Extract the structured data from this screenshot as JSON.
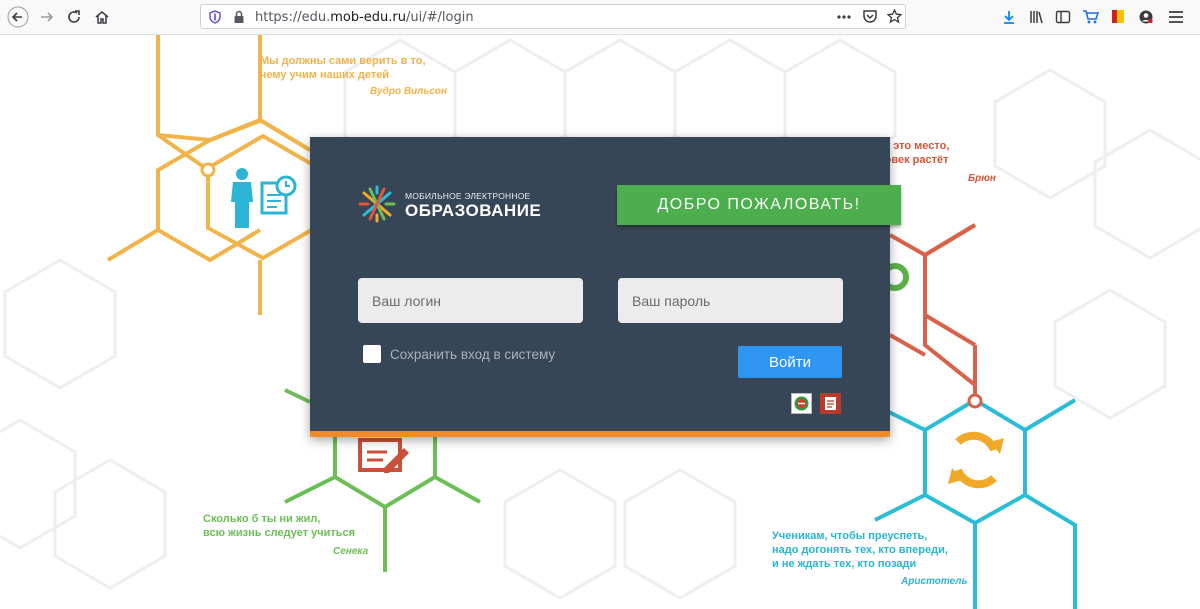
{
  "browser": {
    "url_prefix": "https://edu.",
    "url_domain": "mob-edu.ru",
    "url_suffix": "/ui/#/login"
  },
  "quotes": [
    {
      "text_line1": "Мы должны сами верить в то,",
      "text_line2": "чему учим наших детей",
      "author": "Вудро Вильсон",
      "color": "#f0b24a"
    },
    {
      "text_line1": "Школа – это место,",
      "text_line2": "где человек растёт",
      "author": "Брюн",
      "color": "#d4553b"
    },
    {
      "text_line1": "Сколько б ты ни жил,",
      "text_line2": "всю жизнь следует учиться",
      "author": "Сенека",
      "color": "#6cbe56"
    },
    {
      "text_line1": "Ученикам, чтобы преуспеть,",
      "text_line2": "надо догонять тех, кто впереди,",
      "text_line3": "и не ждать тех, кто позади",
      "author": "Аристотель",
      "color": "#2bb4d3"
    }
  ],
  "login": {
    "logo_small": "МОБИЛЬНОЕ ЭЛЕКТРОННОЕ",
    "logo_big": "ОБРАЗОВАНИЕ",
    "welcome": "ДОБРО ПОЖАЛОВАТЬ!",
    "login_placeholder": "Ваш логин",
    "password_placeholder": "Ваш пароль",
    "remember_label": "Сохранить вход в систему",
    "submit_label": "Войти"
  },
  "colors": {
    "panel_bg": "#374656",
    "accent_orange": "#f08a2a",
    "welcome_green": "#4cae4c",
    "login_blue": "#2e96f0"
  }
}
